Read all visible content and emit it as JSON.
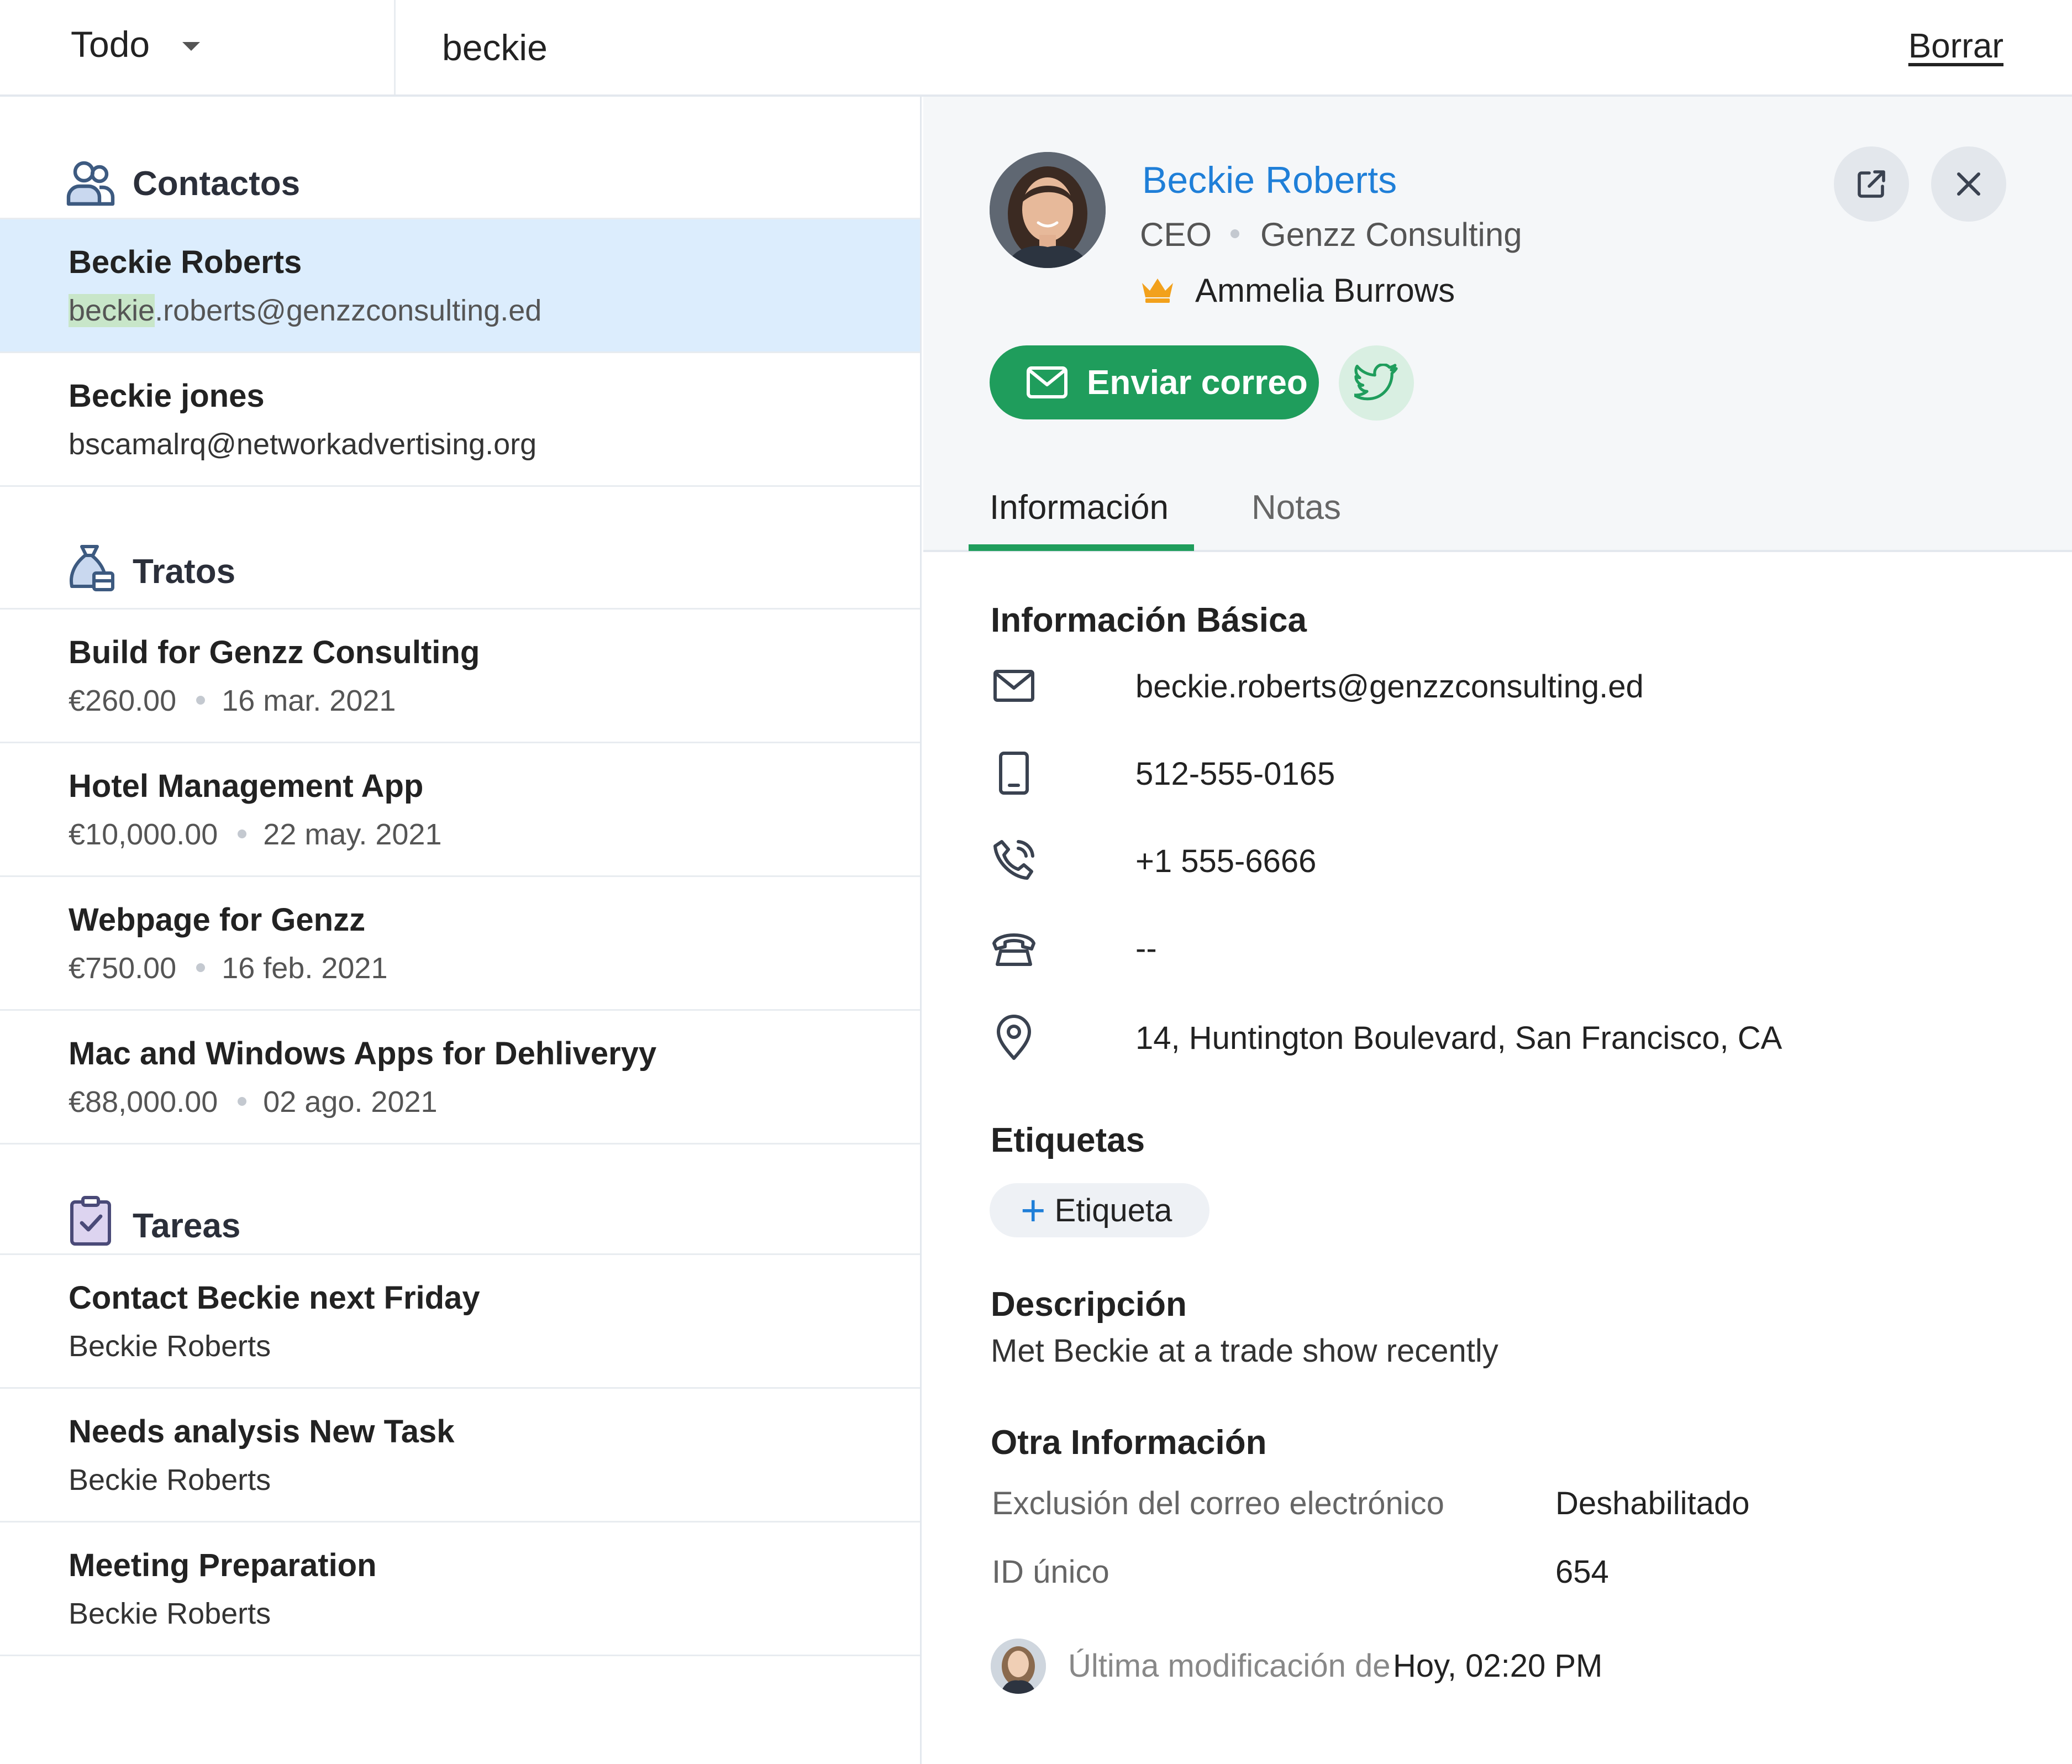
{
  "search": {
    "scope_label": "Todo",
    "query": "beckie",
    "clear_label": "Borrar"
  },
  "sections": {
    "contacts": {
      "title": "Contactos",
      "items": [
        {
          "name": "Beckie Roberts",
          "email_match": "beckie",
          "email_rest": ".roberts@genzzconsulting.ed",
          "selected": true
        },
        {
          "name": "Beckie jones",
          "email": "bscamalrq@networkadvertising.org"
        }
      ]
    },
    "deals": {
      "title": "Tratos",
      "items": [
        {
          "title": "Build for Genzz Consulting",
          "amount": "€260.00",
          "date": "16 mar. 2021"
        },
        {
          "title": "Hotel Management App",
          "amount": "€10,000.00",
          "date": "22 may. 2021"
        },
        {
          "title": "Webpage for Genzz",
          "amount": "€750.00",
          "date": "16 feb. 2021"
        },
        {
          "title": "Mac and Windows Apps for Dehliveryy",
          "amount": "€88,000.00",
          "date": "02 ago. 2021"
        }
      ]
    },
    "tasks": {
      "title": "Tareas",
      "items": [
        {
          "title": "Contact Beckie next Friday",
          "contact": "Beckie Roberts"
        },
        {
          "title": "Needs analysis New Task",
          "contact": "Beckie Roberts"
        },
        {
          "title": "Meeting Preparation",
          "contact": "Beckie Roberts"
        }
      ]
    }
  },
  "detail": {
    "name": "Beckie Roberts",
    "title": "CEO",
    "company": "Genzz Consulting",
    "owner": "Ammelia Burrows",
    "send_email_label": "Enviar correo",
    "tabs": [
      {
        "label": "Información",
        "active": true
      },
      {
        "label": "Notas",
        "active": false
      }
    ],
    "basic_info": {
      "heading": "Información Básica",
      "email": "beckie.roberts@genzzconsulting.ed",
      "mobile": "512-555-0165",
      "phone": "+1 555-6666",
      "home_phone": "--",
      "address": "14, Huntington Boulevard, San Francisco, CA"
    },
    "tags": {
      "heading": "Etiquetas",
      "add_label": "Etiqueta"
    },
    "description": {
      "heading": "Descripción",
      "text": "Met Beckie at a trade show recently"
    },
    "other_info": {
      "heading": "Otra Información",
      "rows": [
        {
          "label": "Exclusión del correo electrónico",
          "value": "Deshabilitado"
        },
        {
          "label": "ID único",
          "value": "654"
        }
      ]
    },
    "last_modified": {
      "label": "Última modificación de",
      "value": "Hoy, 02:20 PM"
    }
  },
  "colors": {
    "accent_green": "#1f9d5c",
    "link_blue": "#1f7fd8",
    "selected_row": "#dcedfd",
    "highlight": "#c8e6c9",
    "crown": "#f2a11c"
  },
  "icons": [
    "contacts-icon",
    "deals-bag-icon",
    "tasks-clipboard-icon",
    "external-link-icon",
    "close-icon",
    "mail-icon",
    "twitter-icon",
    "crown-icon",
    "mobile-icon",
    "phone-icon",
    "home-phone-icon",
    "location-pin-icon",
    "plus-icon",
    "chevron-down-icon"
  ]
}
